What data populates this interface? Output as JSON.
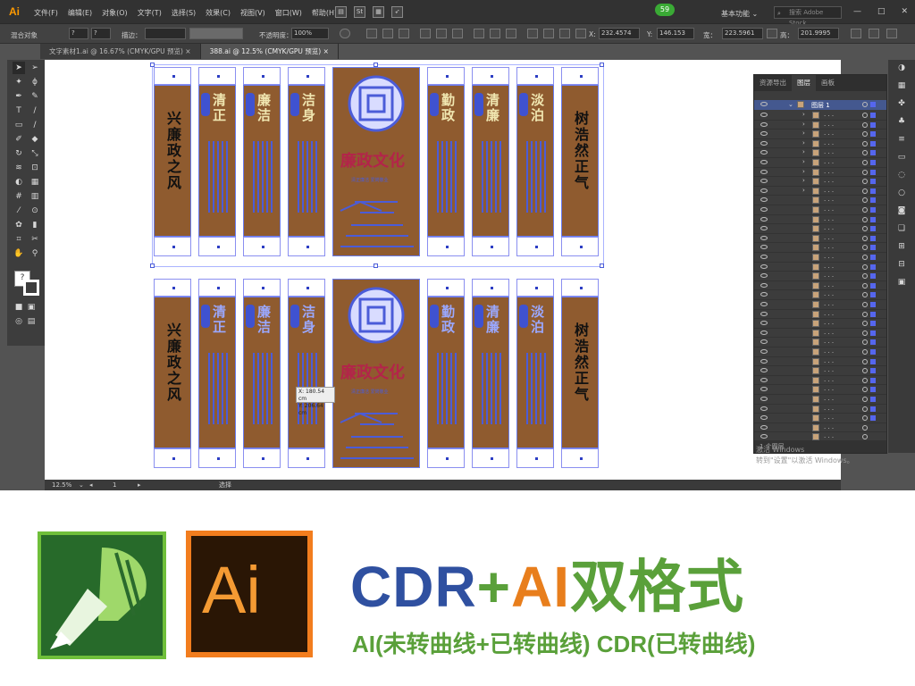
{
  "app": {
    "logo": "Ai"
  },
  "menubar": {
    "items": [
      "文件(F)",
      "编辑(E)",
      "对象(O)",
      "文字(T)",
      "选择(S)",
      "效果(C)",
      "视图(V)",
      "窗口(W)",
      "帮助(H)"
    ],
    "badge": "59",
    "workspace": "基本功能",
    "search_placeholder": "搜索 Adobe Stock",
    "window_buttons": [
      "—",
      "□",
      "✕"
    ]
  },
  "control_bar": {
    "selection_label": "混合对象",
    "stroke_label": "描边：",
    "opacity_label": "不透明度：",
    "opacity_value": "100%",
    "x_label": "X:",
    "x_value": "232.4574",
    "y_label": "Y:",
    "y_value": "146.153",
    "w_label": "宽：",
    "w_value": "223.5961",
    "h_label": "高：",
    "h_value": "201.9995"
  },
  "tabs": [
    {
      "label": "文字素材1.ai @ 16.67% (CMYK/GPU 预览)",
      "close": "×"
    },
    {
      "label": "388.ai @ 12.5% (CMYK/GPU 预览)",
      "close": "×"
    }
  ],
  "artwork": {
    "row1": [
      "兴廉政之风",
      "清正",
      "廉洁",
      "洁身",
      "廉政文化",
      "勤政",
      "清廉",
      "淡泊",
      "树浩然正气"
    ],
    "center_title": "廉政文化",
    "center_sub": "清正廉洁 爱岗敬业"
  },
  "tooltip": {
    "x_line": "X: 180.54 cm",
    "y_line": "Y: 206.64 cm"
  },
  "layers_panel": {
    "tabs": [
      "资源导出",
      "图层",
      "画板"
    ],
    "layer_name": "图层 1",
    "footer": "1 个图层"
  },
  "status_bar": {
    "zoom": "12.5%",
    "page": "1",
    "tool": "选择"
  },
  "watermark_notice": [
    "激活 Windows",
    "转到\"设置\"以激活 Windows。"
  ],
  "banner": {
    "cdr_text": "CDR",
    "plus": "+",
    "ai_text": "AI",
    "suffix": "双格式",
    "subline": "AI(未转曲线+已转曲线) CDR(已转曲线)",
    "ai_logo": "Ai"
  },
  "colors": {
    "ai_orange": "#f27d1e",
    "cdr_green": "#2a6a2d",
    "blue": "#2f50a0",
    "green": "#5aa03a",
    "panel_brown": "#8f5b2f"
  }
}
